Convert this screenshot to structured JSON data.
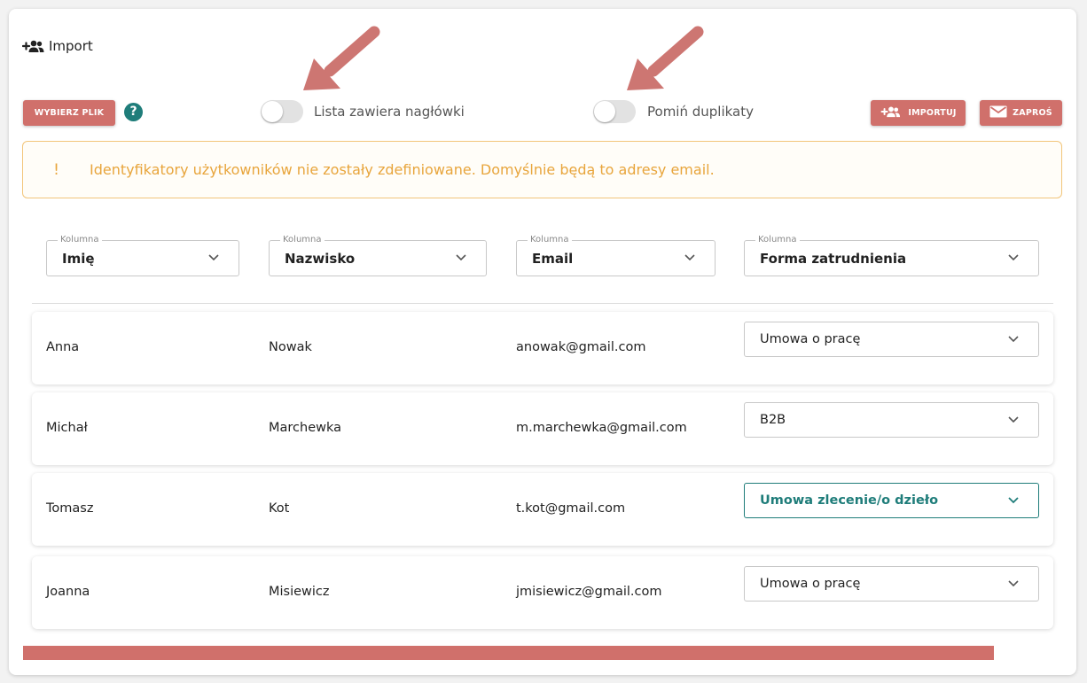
{
  "header": {
    "title": "Import"
  },
  "toolbar": {
    "choose_file_label": "WYBIERZ PLIK",
    "help_symbol": "?",
    "headers_toggle_label": "Lista zawiera nagłówki",
    "skip_duplicates_label": "Pomiń duplikaty",
    "import_label": "IMPORTUJ",
    "invite_label": "ZAPROŚ"
  },
  "alert": {
    "symbol": "!",
    "message": "Identyfikatory użytkowników nie zostały zdefiniowane. Domyślnie będą to adresy email."
  },
  "columns": [
    {
      "legend": "Kolumna",
      "value": "Imię"
    },
    {
      "legend": "Kolumna",
      "value": "Nazwisko"
    },
    {
      "legend": "Kolumna",
      "value": "Email"
    },
    {
      "legend": "Kolumna",
      "value": "Forma zatrudnienia"
    }
  ],
  "rows": [
    {
      "first": "Anna",
      "last": "Nowak",
      "email": "anowak@gmail.com",
      "employment": "Umowa o pracę"
    },
    {
      "first": "Michał",
      "last": "Marchewka",
      "email": "m.marchewka@gmail.com",
      "employment": "B2B"
    },
    {
      "first": "Tomasz",
      "last": "Kot",
      "email": "t.kot@gmail.com",
      "employment": "Umowa zlecenie/o dzieło"
    },
    {
      "first": "Joanna",
      "last": "Misiewicz",
      "email": "jmisiewicz@gmail.com",
      "employment": "Umowa o pracę"
    }
  ],
  "toggles": {
    "headers_on": false,
    "skip_duplicates_on": false
  },
  "colors": {
    "accent": "#d0706b",
    "teal": "#1f7d7a",
    "warning": "#e8a53c",
    "warning_border": "#f2c57a"
  },
  "icons": [
    "add-user-icon",
    "help-icon",
    "mail-icon",
    "chevron-down-icon",
    "arrow-annotation-icon"
  ]
}
